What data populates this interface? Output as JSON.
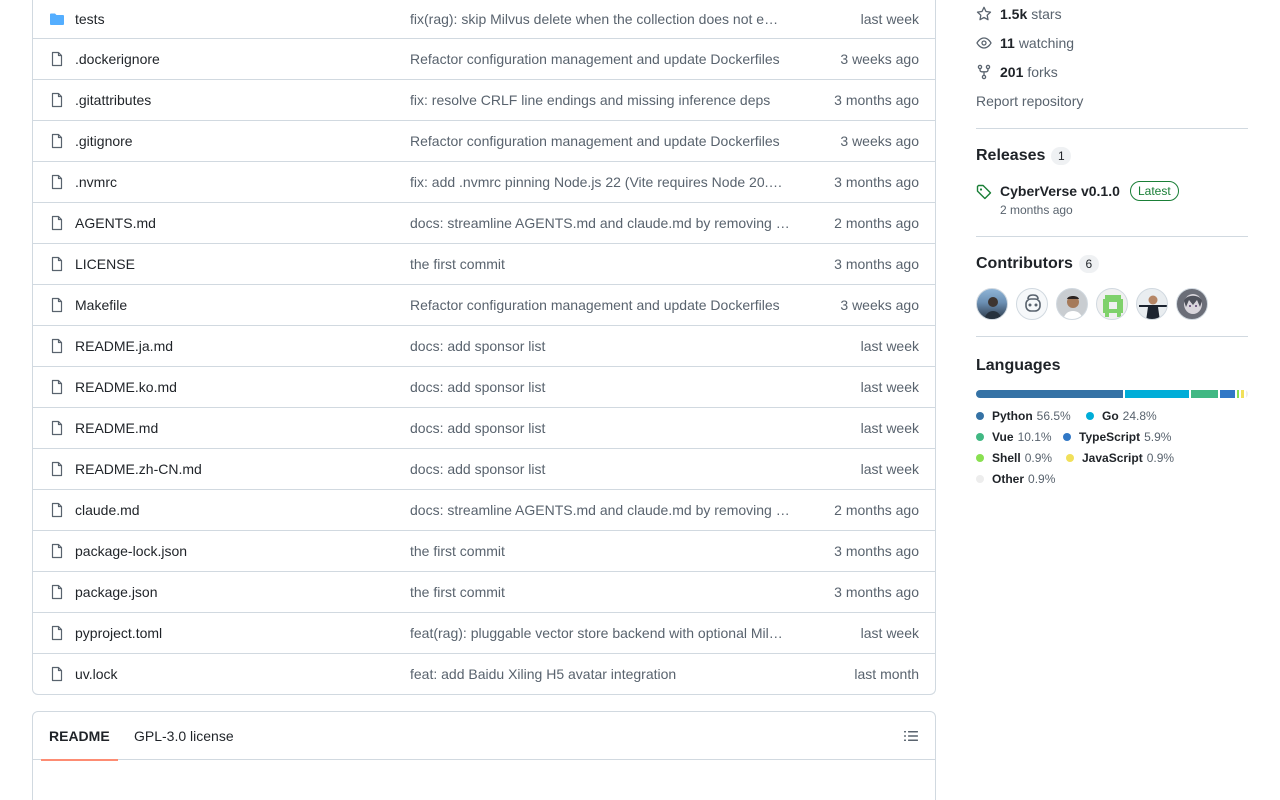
{
  "files": [
    {
      "name": "tests",
      "type": "folder",
      "message": "fix(rag): skip Milvus delete when the collection does not e…",
      "age": "last week"
    },
    {
      "name": ".dockerignore",
      "type": "file",
      "message": "Refactor configuration management and update Dockerfiles",
      "age": "3 weeks ago"
    },
    {
      "name": ".gitattributes",
      "type": "file",
      "message": "fix: resolve CRLF line endings and missing inference deps",
      "age": "3 months ago"
    },
    {
      "name": ".gitignore",
      "type": "file",
      "message": "Refactor configuration management and update Dockerfiles",
      "age": "3 weeks ago"
    },
    {
      "name": ".nvmrc",
      "type": "file",
      "message": "fix: add .nvmrc pinning Node.js 22 (Vite requires Node 20.…",
      "age": "3 months ago"
    },
    {
      "name": "AGENTS.md",
      "type": "file",
      "message": "docs: streamline AGENTS.md and claude.md by removing …",
      "age": "2 months ago"
    },
    {
      "name": "LICENSE",
      "type": "file",
      "message": "the first commit",
      "age": "3 months ago"
    },
    {
      "name": "Makefile",
      "type": "file",
      "message": "Refactor configuration management and update Dockerfiles",
      "age": "3 weeks ago"
    },
    {
      "name": "README.ja.md",
      "type": "file",
      "message": "docs: add sponsor list",
      "age": "last week"
    },
    {
      "name": "README.ko.md",
      "type": "file",
      "message": "docs: add sponsor list",
      "age": "last week"
    },
    {
      "name": "README.md",
      "type": "file",
      "message": "docs: add sponsor list",
      "age": "last week"
    },
    {
      "name": "README.zh-CN.md",
      "type": "file",
      "message": "docs: add sponsor list",
      "age": "last week"
    },
    {
      "name": "claude.md",
      "type": "file",
      "message": "docs: streamline AGENTS.md and claude.md by removing …",
      "age": "2 months ago"
    },
    {
      "name": "package-lock.json",
      "type": "file",
      "message": "the first commit",
      "age": "3 months ago"
    },
    {
      "name": "package.json",
      "type": "file",
      "message": "the first commit",
      "age": "3 months ago"
    },
    {
      "name": "pyproject.toml",
      "type": "file",
      "message": "feat(rag): pluggable vector store backend with optional Mil…",
      "age": "last week"
    },
    {
      "name": "uv.lock",
      "type": "file",
      "message": "feat: add Baidu Xiling H5 avatar integration",
      "age": "last month"
    }
  ],
  "readme": {
    "tab_readme": "README",
    "tab_license": "GPL-3.0 license",
    "toc_icon": "list-unordered-icon"
  },
  "about": {
    "stars_count": "1.5k",
    "stars_label": "stars",
    "watching_count": "11",
    "watching_label": "watching",
    "forks_count": "201",
    "forks_label": "forks",
    "report": "Report repository"
  },
  "releases": {
    "title": "Releases",
    "count": "1",
    "name": "CyberVerse v0.1.0",
    "badge": "Latest",
    "date": "2 months ago"
  },
  "contributors": {
    "title": "Contributors",
    "count": "6"
  },
  "languages": {
    "title": "Languages",
    "items": [
      {
        "name": "Python",
        "percent": "56.5%",
        "value": 56.5,
        "color": "#3572A5"
      },
      {
        "name": "Go",
        "percent": "24.8%",
        "value": 24.8,
        "color": "#00ADD8"
      },
      {
        "name": "Vue",
        "percent": "10.1%",
        "value": 10.1,
        "color": "#41b883"
      },
      {
        "name": "TypeScript",
        "percent": "5.9%",
        "value": 5.9,
        "color": "#3178c6"
      },
      {
        "name": "Shell",
        "percent": "0.9%",
        "value": 0.9,
        "color": "#89e051"
      },
      {
        "name": "JavaScript",
        "percent": "0.9%",
        "value": 0.9,
        "color": "#f1e05a"
      },
      {
        "name": "Other",
        "percent": "0.9%",
        "value": 0.9,
        "color": "#ededed"
      }
    ]
  }
}
